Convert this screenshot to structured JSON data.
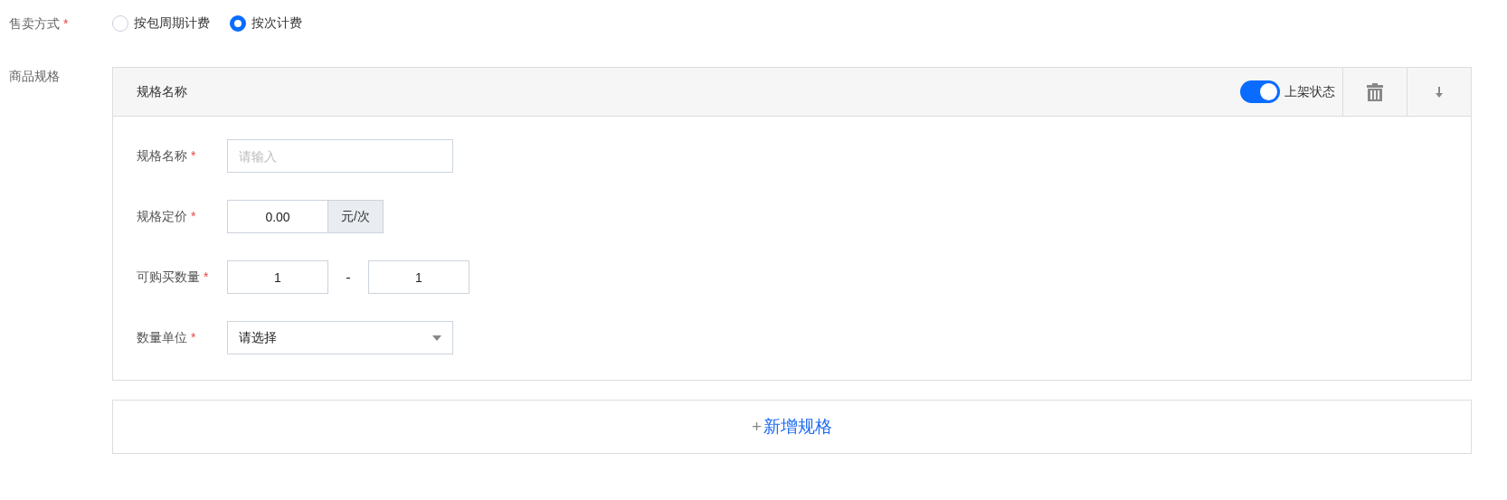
{
  "sale_mode": {
    "label": "售卖方式",
    "mark": "*",
    "options": [
      {
        "label": "按包周期计费",
        "selected": false
      },
      {
        "label": "按次计费",
        "selected": true
      }
    ]
  },
  "spec_section": {
    "label": "商品规格",
    "panel": {
      "title": "规格名称",
      "status": {
        "label": "上架状态",
        "on": true
      },
      "fields": [
        {
          "kind": "text",
          "label": "规格名称",
          "mark": "*",
          "placeholder": "请输入"
        },
        {
          "kind": "price",
          "label": "规格定价",
          "mark": "*",
          "value": "0.00",
          "unit": "元/次"
        },
        {
          "kind": "range",
          "label": "可购买数量",
          "mark": "*",
          "from": "1",
          "separator": "-",
          "to": "1"
        },
        {
          "kind": "select",
          "label": "数量单位",
          "mark": "*",
          "value": "请选择"
        }
      ]
    },
    "add_button": {
      "icon": "+",
      "label": "新增规格"
    }
  }
}
